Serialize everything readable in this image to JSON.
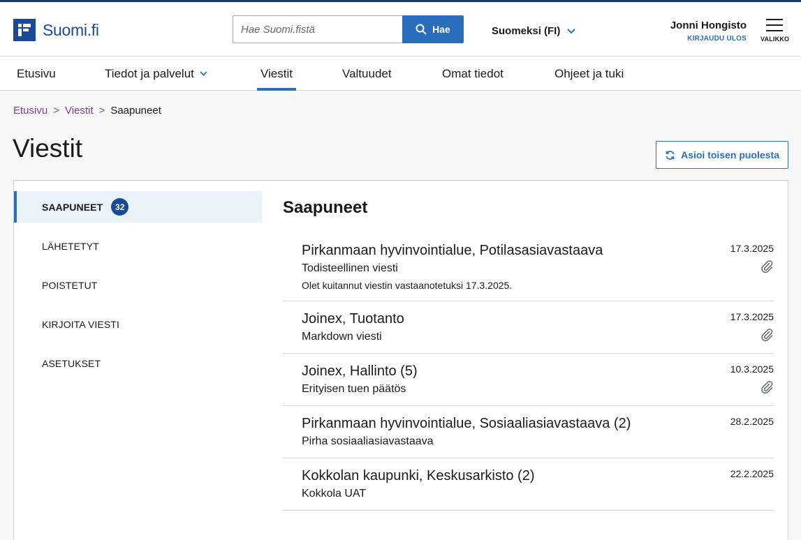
{
  "header": {
    "logo_text": "Suomi.fi",
    "search_placeholder": "Hae Suomi.fistä",
    "search_button": "Hae",
    "language": "Suomeksi (FI)",
    "user_name": "Jonni Hongisto",
    "logout": "KIRJAUDU ULOS",
    "menu_label": "VALIKKO"
  },
  "nav": {
    "items": [
      {
        "label": "Etusivu"
      },
      {
        "label": "Tiedot ja palvelut"
      },
      {
        "label": "Viestit"
      },
      {
        "label": "Valtuudet"
      },
      {
        "label": "Omat tiedot"
      },
      {
        "label": "Ohjeet ja tuki"
      }
    ],
    "active": "Viestit"
  },
  "breadcrumb": {
    "items": [
      "Etusivu",
      "Viestit",
      "Saapuneet"
    ],
    "separator": ">"
  },
  "page": {
    "title": "Viestit",
    "on_behalf_button": "Asioi toisen puolesta"
  },
  "sidebar": {
    "items": [
      {
        "label": "SAAPUNEET",
        "count": "32"
      },
      {
        "label": "LÄHETETYT"
      },
      {
        "label": "POISTETUT"
      },
      {
        "label": "KIRJOITA VIESTI"
      },
      {
        "label": "ASETUKSET"
      }
    ]
  },
  "inbox": {
    "heading": "Saapuneet",
    "messages": [
      {
        "sender": "Pirkanmaan hyvinvointialue, Potilasasiavastaava",
        "subject": "Todisteellinen viesti",
        "note": "Olet kuitannut viestin vastaanotetuksi 17.3.2025.",
        "date": "17.3.2025",
        "attachment": true
      },
      {
        "sender": "Joinex, Tuotanto",
        "subject": "Markdown viesti",
        "date": "17.3.2025",
        "attachment": true
      },
      {
        "sender": "Joinex, Hallinto (5)",
        "subject": "Erityisen tuen päätös",
        "date": "10.3.2025",
        "attachment": true
      },
      {
        "sender": "Pirkanmaan hyvinvointialue, Sosiaaliasiavastaava (2)",
        "subject": "Pirha sosiaaliasiavastaava",
        "date": "28.2.2025",
        "attachment": false
      },
      {
        "sender": "Kokkolan kaupunki, Keskusarkisto (2)",
        "subject": "Kokkola UAT",
        "date": "22.2.2025",
        "attachment": false
      }
    ]
  },
  "colors": {
    "brand": "#1a4a96",
    "accent": "#2a6ebb",
    "link_visited": "#7f3e8a"
  }
}
